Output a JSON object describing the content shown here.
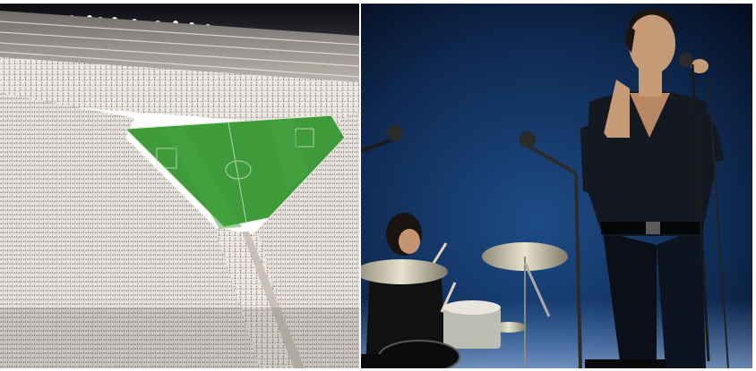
{
  "collage": {
    "left_panel": {
      "subject": "stadium-crowd-photo",
      "pitch_color": "#3f9a3a",
      "crowd_color": "#e9e4df"
    },
    "right_panel": {
      "subject": "concert-stage-photo",
      "backdrop_color": "#0f2a52",
      "accent_color": "#1f5fa8"
    }
  }
}
